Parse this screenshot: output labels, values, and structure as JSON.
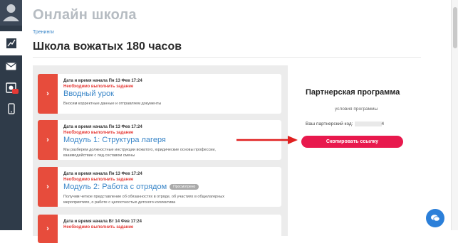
{
  "app": {
    "title": "Онлайн школа"
  },
  "breadcrumb": {
    "item": "Тренинги"
  },
  "page": {
    "title": "Школа вожатых 180 часов"
  },
  "sidebar": {
    "items": [
      {
        "icon": "avatar-icon"
      },
      {
        "icon": "chart-icon",
        "active": true
      },
      {
        "icon": "mail-icon"
      },
      {
        "icon": "video-icon",
        "badge": true
      },
      {
        "icon": "mobile-icon"
      }
    ]
  },
  "lessons": [
    {
      "meta": "Дата и время начала Пн 13 Фев 17:24",
      "warning": "Необходимо выполнить задание",
      "title": "Вводный урок",
      "description": "Вносим корректные данные и отправляем документы",
      "badge": ""
    },
    {
      "meta": "Дата и время начала Пн 13 Фев 17:24",
      "warning": "Необходимо выполнить задание",
      "title": "Модуль 1: Структура лагеря",
      "description": "Мы разберем должностные инструкции вожатого, юридические основы профессии, взаимодействие с пед.составом смены",
      "badge": ""
    },
    {
      "meta": "Дата и время начала Пн 13 Фев 17:24",
      "warning": "Необходимо выполнить задание",
      "title": "Модуль 2: Работа с отрядом",
      "description": "Получим четкое представление об обязанностях в отряде, об участиях в общелагерных мероприятиях, о работе с целостностью детского коллектива",
      "badge": "Просмотрено"
    },
    {
      "meta": "Дата и время начала Вт 14 Фев 17:24",
      "warning": "Необходимо выполнить задание",
      "title": "",
      "description": "",
      "badge": ""
    }
  ],
  "partner": {
    "title": "Партнерская программа",
    "terms_link": "условия программы",
    "code_label": "Ваш партнерский код:",
    "code_suffix": "4",
    "copy_button": "Скопировать ссылку"
  },
  "colors": {
    "accent": "#e8194d",
    "lesson_tab": "#e74c3c",
    "link": "#3a86c8",
    "sidebar": "#2f3b49",
    "chat": "#2b7fd9"
  }
}
